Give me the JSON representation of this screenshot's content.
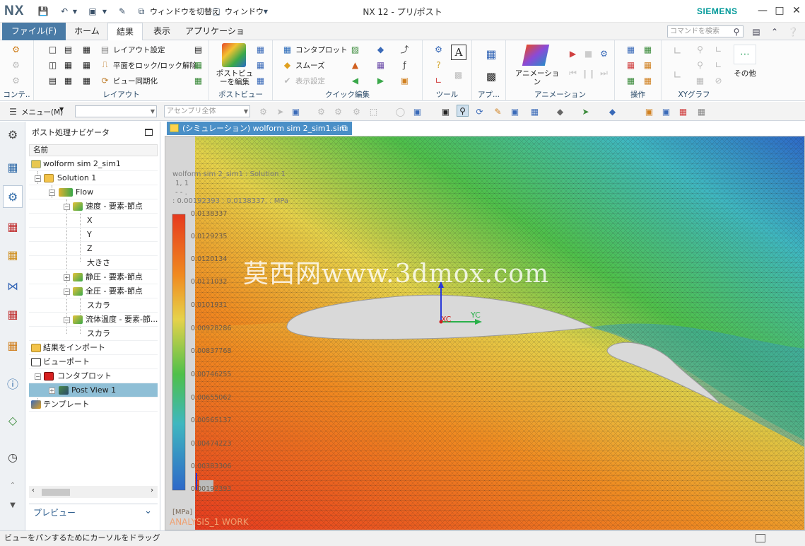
{
  "titlebar": {
    "logo": "NX",
    "title": "NX 12 - プリ/ポスト",
    "brand": "SIEMENS",
    "switch_window": "ウィンドウを切替え",
    "window_menu": "ウィンドウ"
  },
  "tabs": {
    "file": "ファイル(F)",
    "items": [
      "ホーム",
      "結果",
      "表示",
      "アプリケーション"
    ],
    "active": "結果",
    "search_placeholder": "コマンドを検索"
  },
  "ribbon": {
    "groups": {
      "context": "コンテ..",
      "layout": "レイアウト",
      "postview": "ポストビュー",
      "quick_edit": "クイック編集",
      "tools": "ツール",
      "app": "アプ...",
      "animation": "アニメーション",
      "operation": "操作",
      "xygraph": "XYグラフ"
    },
    "layout_settings": "レイアウト設定",
    "lock_plane": "平面をロック/ロック解除",
    "view_sync": "ビュー同期化",
    "edit_postview": "ポストビューを編集",
    "contour_plot": "コンタプロット",
    "smooth": "スムーズ",
    "display_settings": "表示設定",
    "animation": "アニメーション",
    "other": "その他"
  },
  "selbar": {
    "menu": "メニュー(M)",
    "filter_placeholder": "",
    "assembly_placeholder": "アセンブリ全体"
  },
  "navigator": {
    "title": "ポスト処理ナビゲータ",
    "column": "名前",
    "tree": [
      "wolform sim 2_sim1",
      "Solution 1",
      "Flow",
      "速度 - 要素-節点",
      "X",
      "Y",
      "Z",
      "大きさ",
      "静圧 - 要素-節点",
      "全圧 - 要素-節点",
      "スカラ",
      "流体温度 - 要素-節...",
      "スカラ",
      "結果をインポート",
      "ビューポート",
      "コンタプロット",
      "Post View 1",
      "テンプレート"
    ],
    "preview": "プレビュー"
  },
  "doc_tab": {
    "label": "(シミュレーション) wolform sim 2_sim1.sim"
  },
  "graphics": {
    "header_line1": "wolform sim 2_sim1 : Solution 1",
    "header_line2": "1, 1",
    "header_line3": "- - .",
    "header_line4": ": 0.00192393 : 0.0138337, : MPa",
    "axis_xc": "XC",
    "axis_yc": "YC",
    "watermark": "莫西网www.3dmox.com",
    "unit": "[MPa]",
    "work_label": "ANALYSIS_1 WORK",
    "legend_ticks": [
      "0.0138337",
      "0.0129235",
      "0.0120134",
      "0.0111032",
      "0.0101931",
      "0.00928286",
      "0.00837768",
      "0.00746255",
      "0.00655062",
      "0.00565137",
      "0.00474223",
      "0.00383306",
      "0.00192393"
    ],
    "colors": {
      "red": "#e63a1f",
      "orange": "#f08a20",
      "yellow": "#e6d24a",
      "green": "#4fc04a",
      "cyan": "#3fb7c0",
      "blue": "#2d68c8"
    }
  },
  "status": {
    "text": "ビューをパンするためにカーソルをドラッグ"
  }
}
